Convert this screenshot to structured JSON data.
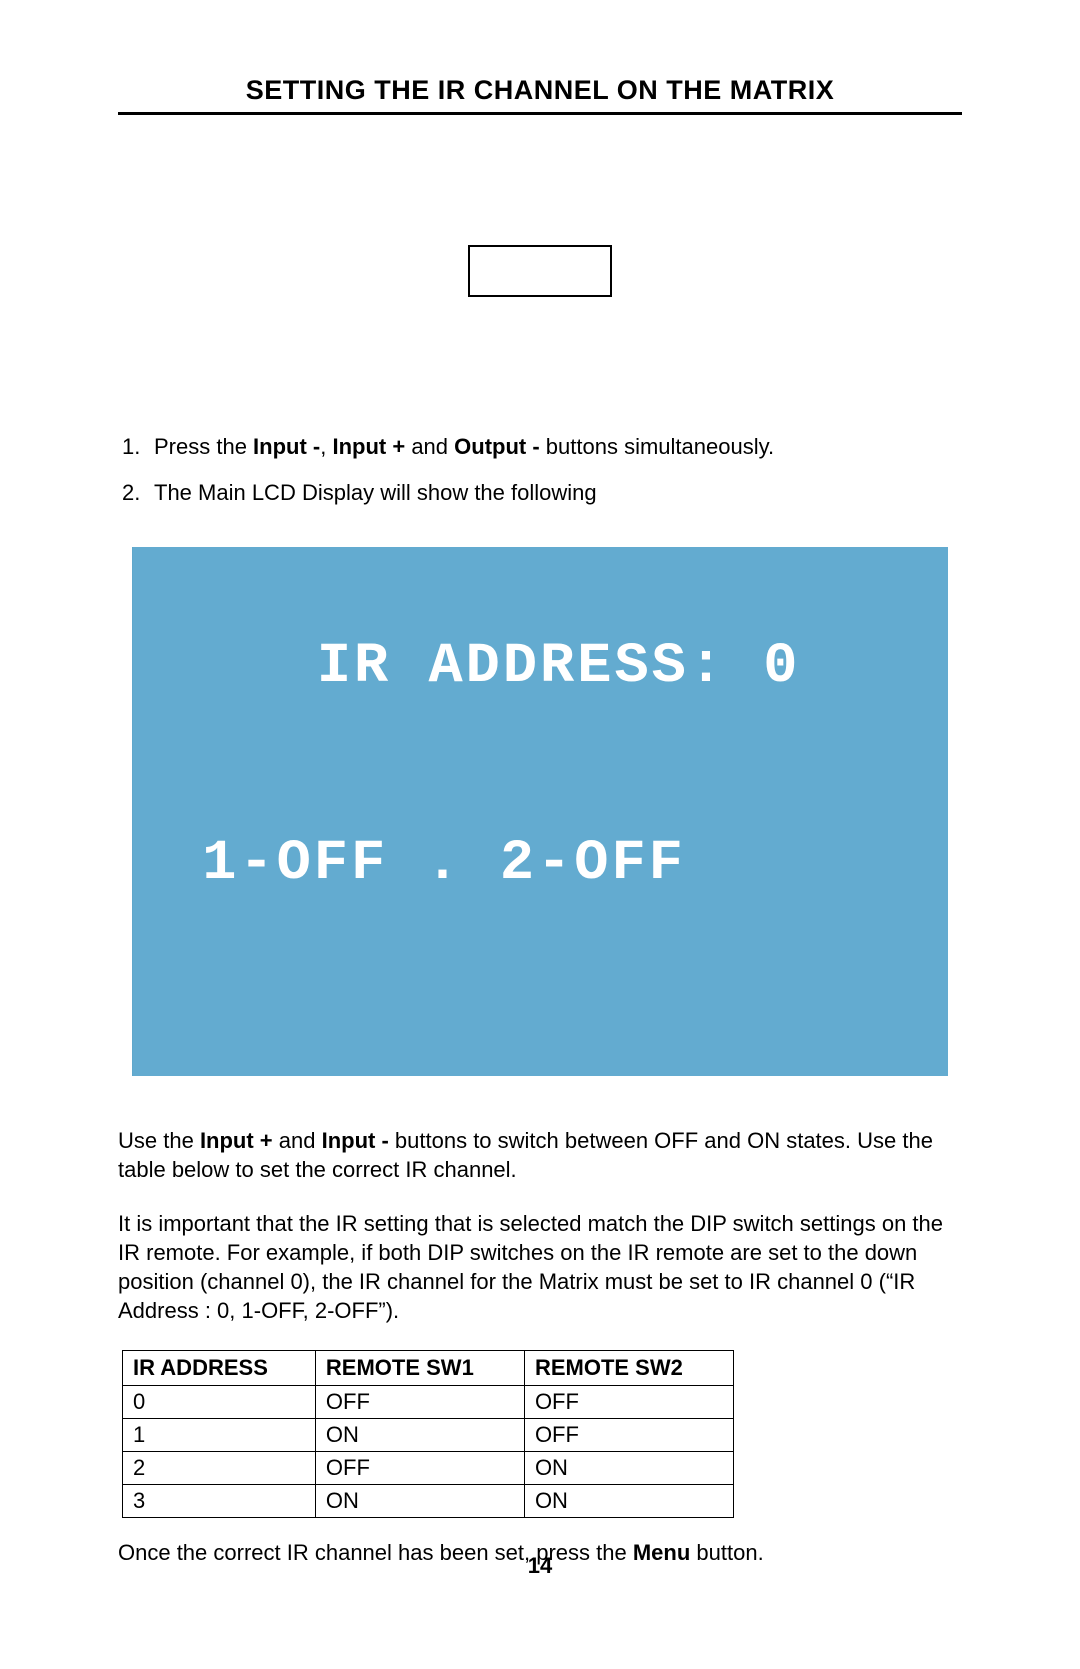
{
  "title": "SETTING THE IR CHANNEL ON THE MATRIX",
  "steps": [
    {
      "num": "1.",
      "parts": [
        {
          "text": "Press the ",
          "bold": false
        },
        {
          "text": "Input -",
          "bold": true
        },
        {
          "text": ", ",
          "bold": false
        },
        {
          "text": "Input +",
          "bold": true
        },
        {
          "text": " and ",
          "bold": false
        },
        {
          "text": "Output -",
          "bold": true
        },
        {
          "text": " buttons simultaneously.",
          "bold": false
        }
      ]
    },
    {
      "num": "2.",
      "parts": [
        {
          "text": "The Main LCD Display will show the following",
          "bold": false
        }
      ]
    }
  ],
  "lcd": {
    "line1": "IR ADDRESS: 0",
    "line2": "1-OFF . 2-OFF"
  },
  "para1_parts": [
    {
      "text": "Use the ",
      "bold": false
    },
    {
      "text": "Input +",
      "bold": true
    },
    {
      "text": " and ",
      "bold": false
    },
    {
      "text": "Input -",
      "bold": true
    },
    {
      "text": " buttons to switch between OFF and ON states.  Use the table below to set the correct IR channel.",
      "bold": false
    }
  ],
  "para2": "It is important that the IR setting that is selected match the DIP switch settings on the IR remote.  For example, if both DIP switches on the IR remote are set to the down position (channel 0), the IR channel for the Matrix must be set to IR channel 0 (“IR Address : 0, 1-OFF, 2-OFF”).",
  "table": {
    "headers": [
      "IR ADDRESS",
      "REMOTE SW1",
      "REMOTE SW2"
    ],
    "rows": [
      [
        "0",
        "OFF",
        "OFF"
      ],
      [
        "1",
        "ON",
        "OFF"
      ],
      [
        "2",
        "OFF",
        "ON"
      ],
      [
        "3",
        "ON",
        "ON"
      ]
    ]
  },
  "para3_parts": [
    {
      "text": "Once the correct IR channel has been set, press the ",
      "bold": false
    },
    {
      "text": "Menu",
      "bold": true
    },
    {
      "text": " button.",
      "bold": false
    }
  ],
  "page_number": "14"
}
